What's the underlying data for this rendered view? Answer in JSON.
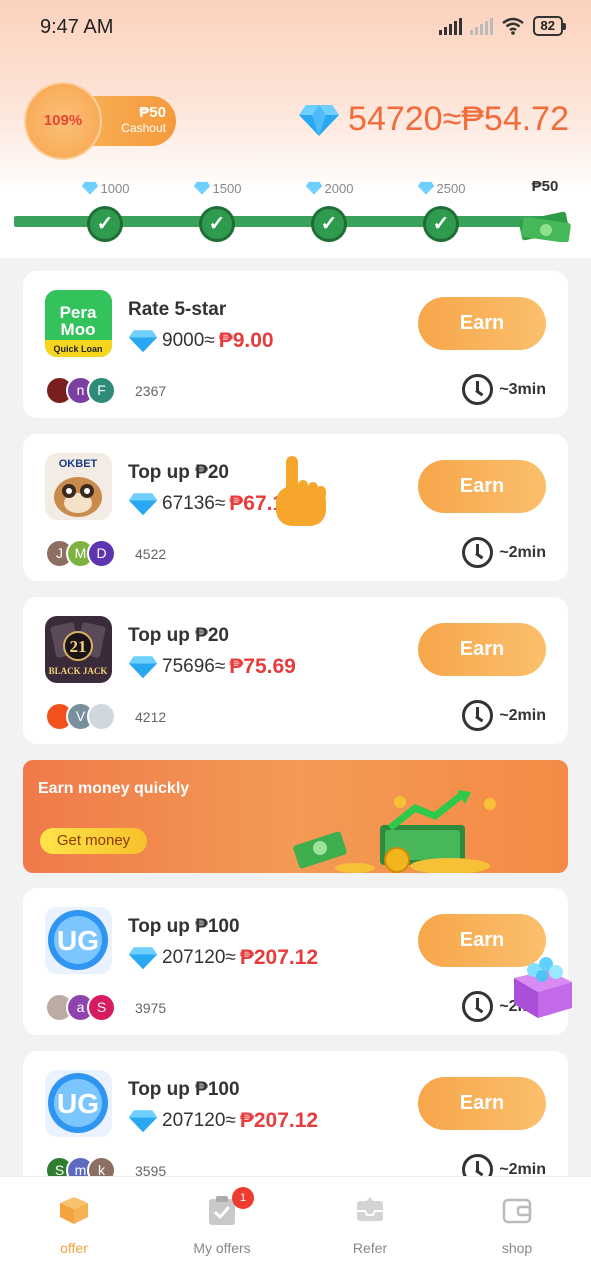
{
  "status_bar": {
    "time": "9:47 AM",
    "battery": "82"
  },
  "header": {
    "percent": "109%",
    "cashout_amount": "₱50",
    "cashout_label": "Cashout",
    "balance": "54720≈₱54.72"
  },
  "milestones": [
    {
      "label": "1000",
      "done": true
    },
    {
      "label": "1500",
      "done": true
    },
    {
      "label": "2000",
      "done": true
    },
    {
      "label": "2500",
      "done": true
    }
  ],
  "goal_label": "₱50",
  "tasks": [
    {
      "app_icon": "peramoo-icon",
      "title": "Rate 5-star",
      "diamonds": "9000≈",
      "php": "₱9.00",
      "earn_label": "Earn",
      "users": "2367",
      "duration": "~3min",
      "avatars": [
        "",
        "n",
        "F"
      ]
    },
    {
      "app_icon": "okbet-icon",
      "title": "Top up ₱20",
      "diamonds": "67136≈",
      "php": "₱67.1",
      "earn_label": "Earn",
      "users": "4522",
      "duration": "~2min",
      "avatars": [
        "J",
        "M",
        "D"
      ]
    },
    {
      "app_icon": "blackjack-icon",
      "title": "Top up ₱20",
      "diamonds": "75696≈",
      "php": "₱75.69",
      "earn_label": "Earn",
      "users": "4212",
      "duration": "~2min",
      "avatars": [
        "",
        "V",
        ""
      ]
    },
    {
      "app_icon": "ug-icon",
      "title": "Top up ₱100",
      "diamonds": "207120≈",
      "php": "₱207.12",
      "earn_label": "Earn",
      "users": "3975",
      "duration": "~2min",
      "avatars": [
        "",
        "a",
        "S"
      ]
    },
    {
      "app_icon": "ug-icon",
      "title": "Top up ₱100",
      "diamonds": "207120≈",
      "php": "₱207.12",
      "earn_label": "Earn",
      "users": "3595",
      "duration": "~2min",
      "avatars": [
        "S",
        "m",
        "k"
      ]
    }
  ],
  "banner": {
    "title": "Earn money quickly",
    "button": "Get money"
  },
  "app_icons": {
    "peramoo_line1": "Pera",
    "peramoo_line2": "Moo",
    "peramoo_tag": "Quick Loan",
    "okbet": "OKBET",
    "blackjack_num": "21",
    "blackjack_text": "BLACK JACK",
    "ug": "UG"
  },
  "nav": [
    {
      "label": "offer",
      "icon": "box-icon",
      "active": true
    },
    {
      "label": "My offers",
      "icon": "clipboard-check-icon",
      "badge": "1"
    },
    {
      "label": "Refer",
      "icon": "inbox-icon"
    },
    {
      "label": "shop",
      "icon": "wallet-icon"
    }
  ],
  "colors": {
    "accent": "#f7a64a",
    "price_red": "#e83c3c",
    "progress_green": "#3aa35b"
  }
}
